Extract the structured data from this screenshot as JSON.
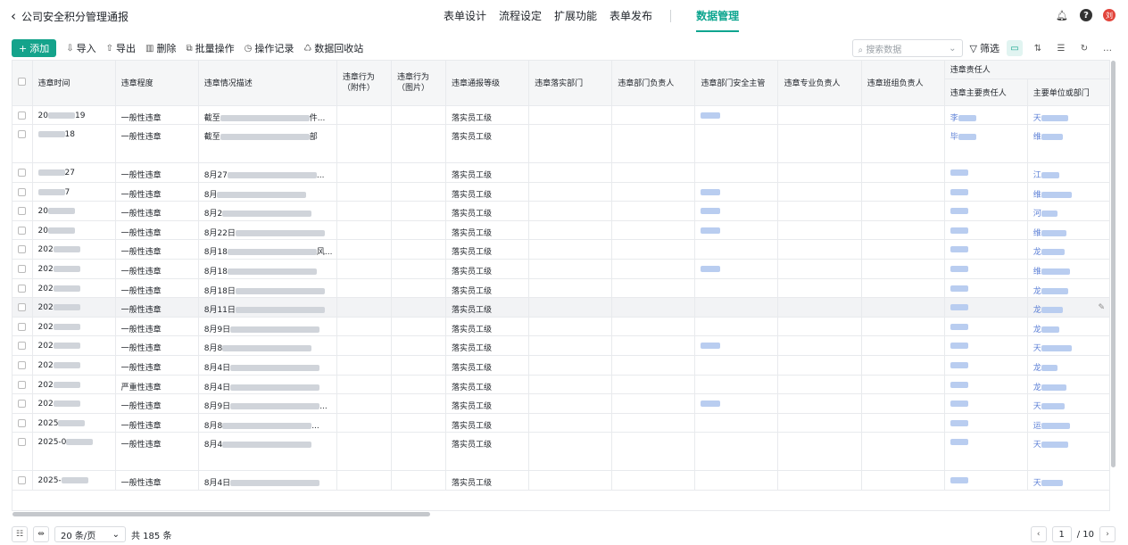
{
  "header": {
    "back_title": "公司安全积分管理通报",
    "tabs": [
      "表单设计",
      "流程设定",
      "扩展功能",
      "表单发布"
    ],
    "active_tab": "数据管理",
    "avatar_text": "刘"
  },
  "toolbar": {
    "add": "添加",
    "import": "导入",
    "export": "导出",
    "delete": "删除",
    "batch": "批量操作",
    "log": "操作记录",
    "recycle": "数据回收站",
    "search_placeholder": "搜索数据",
    "filter": "筛选"
  },
  "table": {
    "columns": {
      "time": "违章时间",
      "degree": "违章程度",
      "desc": "违章情况描述",
      "act_attach": "违章行为（附件）",
      "act_img": "违章行为（图片）",
      "level": "违章通报等级",
      "dept": "违章落实部门",
      "dept_head": "违章部门负责人",
      "dept_safety": "违章部门安全主管",
      "pro_head": "违章专业负责人",
      "team_head": "违章班组负责人",
      "resp_group": "违章责任人",
      "main_resp": "违章主要责任人",
      "main_unit": "主要单位或部门"
    },
    "rows": [
      {
        "time_pre": "20",
        "time_suf": "19",
        "degree": "一般性违章",
        "desc_pre": "截至",
        "desc_suf": "件...",
        "level": "落实员工级",
        "safety": true,
        "resp_pre": "李",
        "unit_pre": "天"
      },
      {
        "time_pre": "",
        "time_suf": "18",
        "degree": "一般性违章",
        "desc_pre": "截至",
        "desc_suf": "部",
        "level": "落实员工级",
        "safety": false,
        "resp_pre": "毕",
        "unit_pre": "维",
        "tall": true
      },
      {
        "time_pre": "",
        "time_suf": "27",
        "degree": "一般性违章",
        "desc_pre": "8月27",
        "desc_suf": "...",
        "level": "落实员工级",
        "safety": false,
        "resp_pre": "",
        "unit_pre": "江"
      },
      {
        "time_pre": "",
        "time_suf": "7",
        "degree": "一般性违章",
        "desc_pre": "8月",
        "desc_suf": "",
        "level": "落实员工级",
        "safety": true,
        "resp_pre": "",
        "unit_pre": "维"
      },
      {
        "time_pre": "20",
        "time_suf": "",
        "degree": "一般性违章",
        "desc_pre": "8月2",
        "desc_suf": "",
        "level": "落实员工级",
        "safety": true,
        "resp_pre": "",
        "unit_pre": "河"
      },
      {
        "time_pre": "20",
        "time_suf": "",
        "degree": "一般性违章",
        "desc_pre": "8月22日",
        "desc_suf": "",
        "level": "落实员工级",
        "safety": true,
        "resp_pre": "",
        "unit_pre": "维"
      },
      {
        "time_pre": "202",
        "time_suf": "",
        "degree": "一般性违章",
        "desc_pre": "8月18",
        "desc_suf": "风...",
        "level": "落实员工级",
        "safety": false,
        "resp_pre": "",
        "unit_pre": "龙"
      },
      {
        "time_pre": "202",
        "time_suf": "",
        "degree": "一般性违章",
        "desc_pre": "8月18",
        "desc_suf": "",
        "level": "落实员工级",
        "safety": true,
        "resp_pre": "",
        "unit_pre": "维"
      },
      {
        "time_pre": "202",
        "time_suf": "",
        "degree": "一般性违章",
        "desc_pre": "8月18日",
        "desc_suf": "",
        "level": "落实员工级",
        "safety": false,
        "resp_pre": "",
        "unit_pre": "龙"
      },
      {
        "time_pre": "202",
        "time_suf": "",
        "degree": "一般性违章",
        "desc_pre": "8月11日",
        "desc_suf": "",
        "level": "落实员工级",
        "safety": false,
        "resp_pre": "",
        "unit_pre": "龙",
        "hl": true
      },
      {
        "time_pre": "202",
        "time_suf": "",
        "degree": "一般性违章",
        "desc_pre": "8月9日",
        "desc_suf": "",
        "level": "落实员工级",
        "safety": false,
        "resp_pre": "",
        "unit_pre": "龙"
      },
      {
        "time_pre": "202",
        "time_suf": "",
        "degree": "一般性违章",
        "desc_pre": "8月8",
        "desc_suf": "",
        "level": "落实员工级",
        "safety": true,
        "resp_pre": "",
        "unit_pre": "天"
      },
      {
        "time_pre": "202",
        "time_suf": "",
        "degree": "一般性违章",
        "desc_pre": "8月4日",
        "desc_suf": "",
        "level": "落实员工级",
        "safety": false,
        "resp_pre": "",
        "unit_pre": "龙"
      },
      {
        "time_pre": "202",
        "time_suf": "",
        "degree": "严重性违章",
        "desc_pre": "8月4日",
        "desc_suf": "",
        "level": "落实员工级",
        "safety": false,
        "resp_pre": "",
        "unit_pre": "龙"
      },
      {
        "time_pre": "202",
        "time_suf": "",
        "degree": "一般性违章",
        "desc_pre": "8月9日",
        "desc_suf": "...",
        "level": "落实员工级",
        "safety": true,
        "resp_pre": "",
        "unit_pre": "天"
      },
      {
        "time_pre": "2025",
        "time_suf": "",
        "degree": "一般性违章",
        "desc_pre": "8月8",
        "desc_suf": "...",
        "level": "落实员工级",
        "safety": false,
        "resp_pre": "",
        "unit_pre": "运"
      },
      {
        "time_pre": "2025-0",
        "time_suf": "",
        "degree": "一般性违章",
        "desc_pre": "8月4",
        "desc_suf": "",
        "level": "落实员工级",
        "safety": false,
        "resp_pre": "",
        "unit_pre": "天",
        "tall": true
      },
      {
        "time_pre": "2025-",
        "time_suf": "",
        "degree": "一般性违章",
        "desc_pre": "8月4日",
        "desc_suf": "",
        "level": "落实员工级",
        "safety": false,
        "resp_pre": "",
        "unit_pre": "天"
      }
    ]
  },
  "footer": {
    "page_size": "20 条/页",
    "total": "共 185 条",
    "current_page": "1",
    "total_pages": "/ 10"
  }
}
